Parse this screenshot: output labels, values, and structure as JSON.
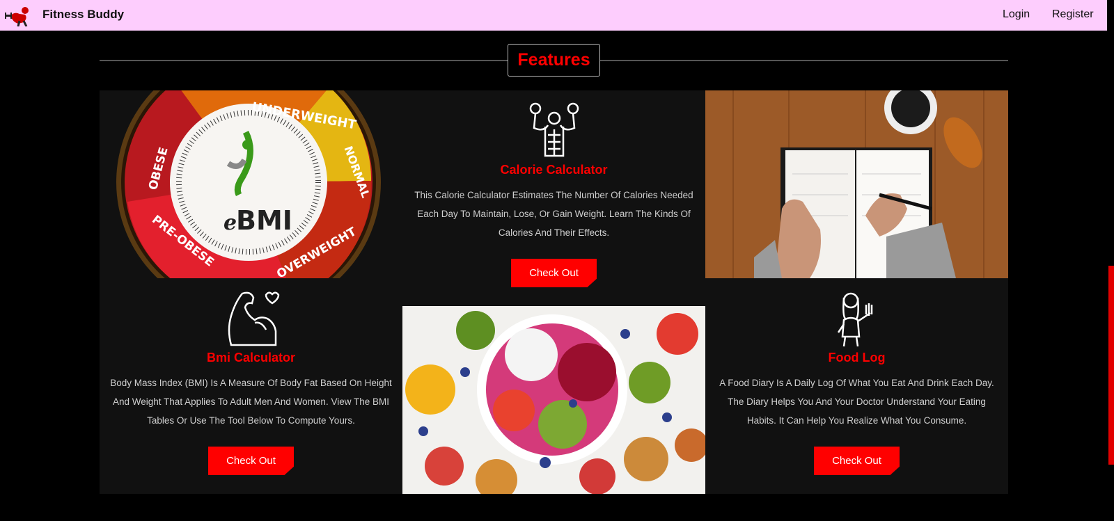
{
  "navbar": {
    "brand": "Fitness Buddy",
    "links": [
      "Login",
      "Register"
    ]
  },
  "section": {
    "title": "Features"
  },
  "cards": [
    {
      "title": "Calorie Calculator",
      "description": "This Calorie Calculator Estimates The Number Of Calories Needed Each Day To Maintain, Lose, Or Gain Weight. Learn The Kinds Of Calories And Their Effects.",
      "button": "Check Out",
      "icon": "bodybuilder-icon"
    },
    {
      "title": "Bmi Calculator",
      "description": "Body Mass Index (BMI) Is A Measure Of Body Fat Based On Height And Weight That Applies To Adult Men And Women. View The BMI Tables Or Use The Tool Below To Compute Yours.",
      "button": "Check Out",
      "icon": "flexed-arm-heart-icon"
    },
    {
      "title": "Food Log",
      "description": "A Food Diary Is A Daily Log Of What You Eat And Drink Each Day. The Diary Helps You And Your Doctor Understand Your Eating Habits. It Can Help You Realize What You Consume.",
      "button": "Check Out",
      "icon": "woman-dumbbell-icon"
    }
  ],
  "bmi_dial": {
    "labels": [
      "UNDERWEIGHT",
      "NORMAL",
      "OVERWEIGHT",
      "PRE-OBESE",
      "OBESE"
    ],
    "logo_text": "BMI",
    "logo_prefix": "e"
  },
  "colors": {
    "accent": "#ff0000",
    "navbar": "#fdcdfd",
    "card_bg": "#111111"
  }
}
